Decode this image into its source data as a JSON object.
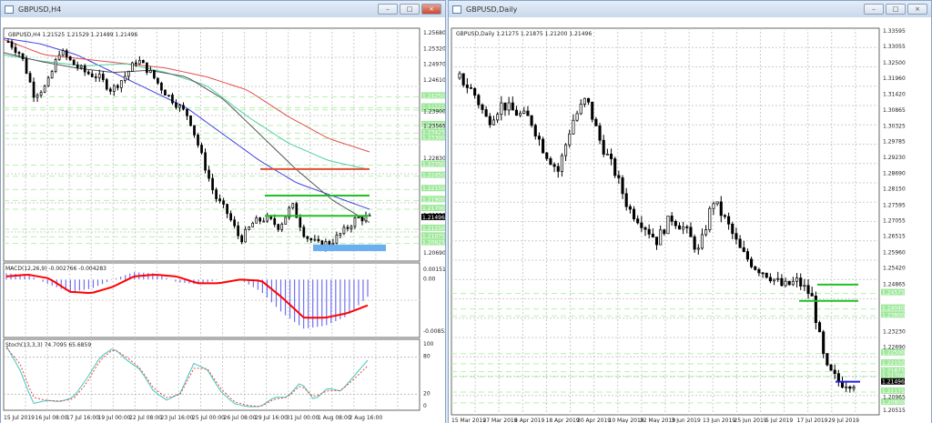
{
  "left_window": {
    "title": "GBPUSD,H4",
    "header": "GBPUSD,H4  1.21525 1.21529 1.21489 1.21496",
    "buttons": [
      "minimize",
      "maximize",
      "close"
    ],
    "price_ticks": [
      "1.25680",
      "1.25320",
      "1.24970",
      "1.24610",
      "1.23900",
      "1.23565",
      "1.22830",
      "1.21550",
      "1.20690"
    ],
    "price_ticks_values": [
      1.2568,
      1.2532,
      1.2497,
      1.2461,
      1.239,
      1.23565,
      1.2283,
      1.2155,
      1.2069
    ],
    "level_labels": [
      "1.24250",
      "1.24000",
      "1.23950",
      "1.23600",
      "1.23425",
      "1.23300",
      "1.22700",
      "1.22450",
      "1.22150",
      "1.21900",
      "1.21700",
      "1.21250",
      "1.21075",
      "1.20925"
    ],
    "current_price": "1.21496",
    "time_labels": [
      "15 Jul 2019",
      "16 Jul 08:00",
      "17 Jul 16:00",
      "19 Jul 00:00",
      "22 Jul 08:00",
      "23 Jul 16:00",
      "25 Jul 00:00",
      "26 Jul 08:00",
      "29 Jul 16:00",
      "31 Jul 00:00",
      "1 Aug 08:00",
      "2 Aug 16:00"
    ],
    "macd": {
      "label": "MACD(12,26,9) -0.002766 -0.004283",
      "ticks": [
        "0.001519",
        "0.00",
        "-0.008525"
      ]
    },
    "stoch": {
      "label": "Stoch(13,3,3) 74.7095 65.6859",
      "ticks": [
        "100",
        "80",
        "20",
        "0"
      ]
    }
  },
  "right_window": {
    "title": "GBPUSD,Daily",
    "header": "GBPUSD,Daily  1.21275 1.21875 1.21200 1.21496",
    "price_ticks": [
      "1.33595",
      "1.33055",
      "1.32500",
      "1.31960",
      "1.31420",
      "1.30865",
      "1.30325",
      "1.29785",
      "1.29230",
      "1.28690",
      "1.28150",
      "1.27595",
      "1.27055",
      "1.26515",
      "1.25960",
      "1.25420",
      "1.24865",
      "1.23230",
      "1.22690",
      "1.20965",
      "1.20515"
    ],
    "level_labels": [
      "1.24575",
      "1.24040",
      "1.23800",
      "1.22500",
      "1.22150",
      "1.21875",
      "1.21700",
      "1.21175",
      "1.20800"
    ],
    "current_price": "1.21496",
    "time_labels": [
      "15 Mar 2019",
      "27 Mar 2019",
      "8 Apr 2019",
      "18 Apr 2019",
      "30 Apr 2019",
      "10 May 2019",
      "22 May 2019",
      "3 Jun 2019",
      "13 Jun 2019",
      "25 Jun 2019",
      "5 Jul 2019",
      "17 Jul 2019",
      "29 Jul 2019"
    ]
  },
  "chart_data": [
    {
      "type": "candlestick",
      "symbol": "GBPUSD",
      "timeframe": "H4",
      "ylim": [
        1.2069,
        1.2568
      ],
      "close_path": [
        1.255,
        1.252,
        1.243,
        1.245,
        1.253,
        1.25,
        1.248,
        1.247,
        1.244,
        1.247,
        1.251,
        1.248,
        1.244,
        1.241,
        1.238,
        1.229,
        1.22,
        1.216,
        1.21,
        1.214,
        1.215,
        1.213,
        1.218,
        1.211,
        1.209,
        1.2095,
        1.212,
        1.215,
        1.215
      ],
      "levels": {
        "red": 1.2261,
        "green": [
          1.2201,
          1.2155
        ],
        "blue_zone": [
          1.2075,
          1.209
        ]
      },
      "macd_signal_path": [
        0.0005,
        0.0008,
        0.0002,
        -0.002,
        -0.0022,
        -0.0012,
        0.0005,
        0.0008,
        0.0005,
        -0.0006,
        -0.0006,
        0.0,
        -0.0002,
        -0.003,
        -0.0062,
        -0.0062,
        -0.0055,
        -0.0042
      ],
      "macd_hist_path": [
        0.001,
        0.0008,
        -0.0008,
        -0.002,
        -0.0015,
        0.0,
        0.0012,
        0.001,
        -0.0004,
        -0.0008,
        0.0,
        0.0,
        -0.002,
        -0.0055,
        -0.008,
        -0.0075,
        -0.006,
        -0.0028
      ],
      "stoch_main_path": [
        98,
        60,
        5,
        10,
        8,
        15,
        45,
        80,
        95,
        75,
        60,
        25,
        10,
        22,
        70,
        60,
        25,
        5,
        0,
        0,
        15,
        15,
        40,
        10,
        30,
        25,
        50,
        75
      ],
      "stoch_signal_path": [
        95,
        70,
        15,
        10,
        9,
        12,
        38,
        75,
        93,
        80,
        62,
        30,
        14,
        20,
        62,
        62,
        30,
        8,
        2,
        0,
        12,
        15,
        35,
        15,
        26,
        26,
        45,
        66
      ]
    },
    {
      "type": "candlestick",
      "symbol": "GBPUSD",
      "timeframe": "Daily",
      "ylim": [
        1.20515,
        1.33595
      ],
      "close_path": [
        1.32,
        1.315,
        1.305,
        1.311,
        1.308,
        1.306,
        1.295,
        1.288,
        1.305,
        1.313,
        1.298,
        1.288,
        1.275,
        1.27,
        1.264,
        1.272,
        1.268,
        1.26,
        1.278,
        1.27,
        1.26,
        1.255,
        1.252,
        1.248,
        1.25,
        1.245,
        1.22,
        1.215,
        1.215
      ],
      "levels": {
        "green": [
          1.2488,
          1.2432
        ],
        "blue": 1.2153
      }
    }
  ]
}
